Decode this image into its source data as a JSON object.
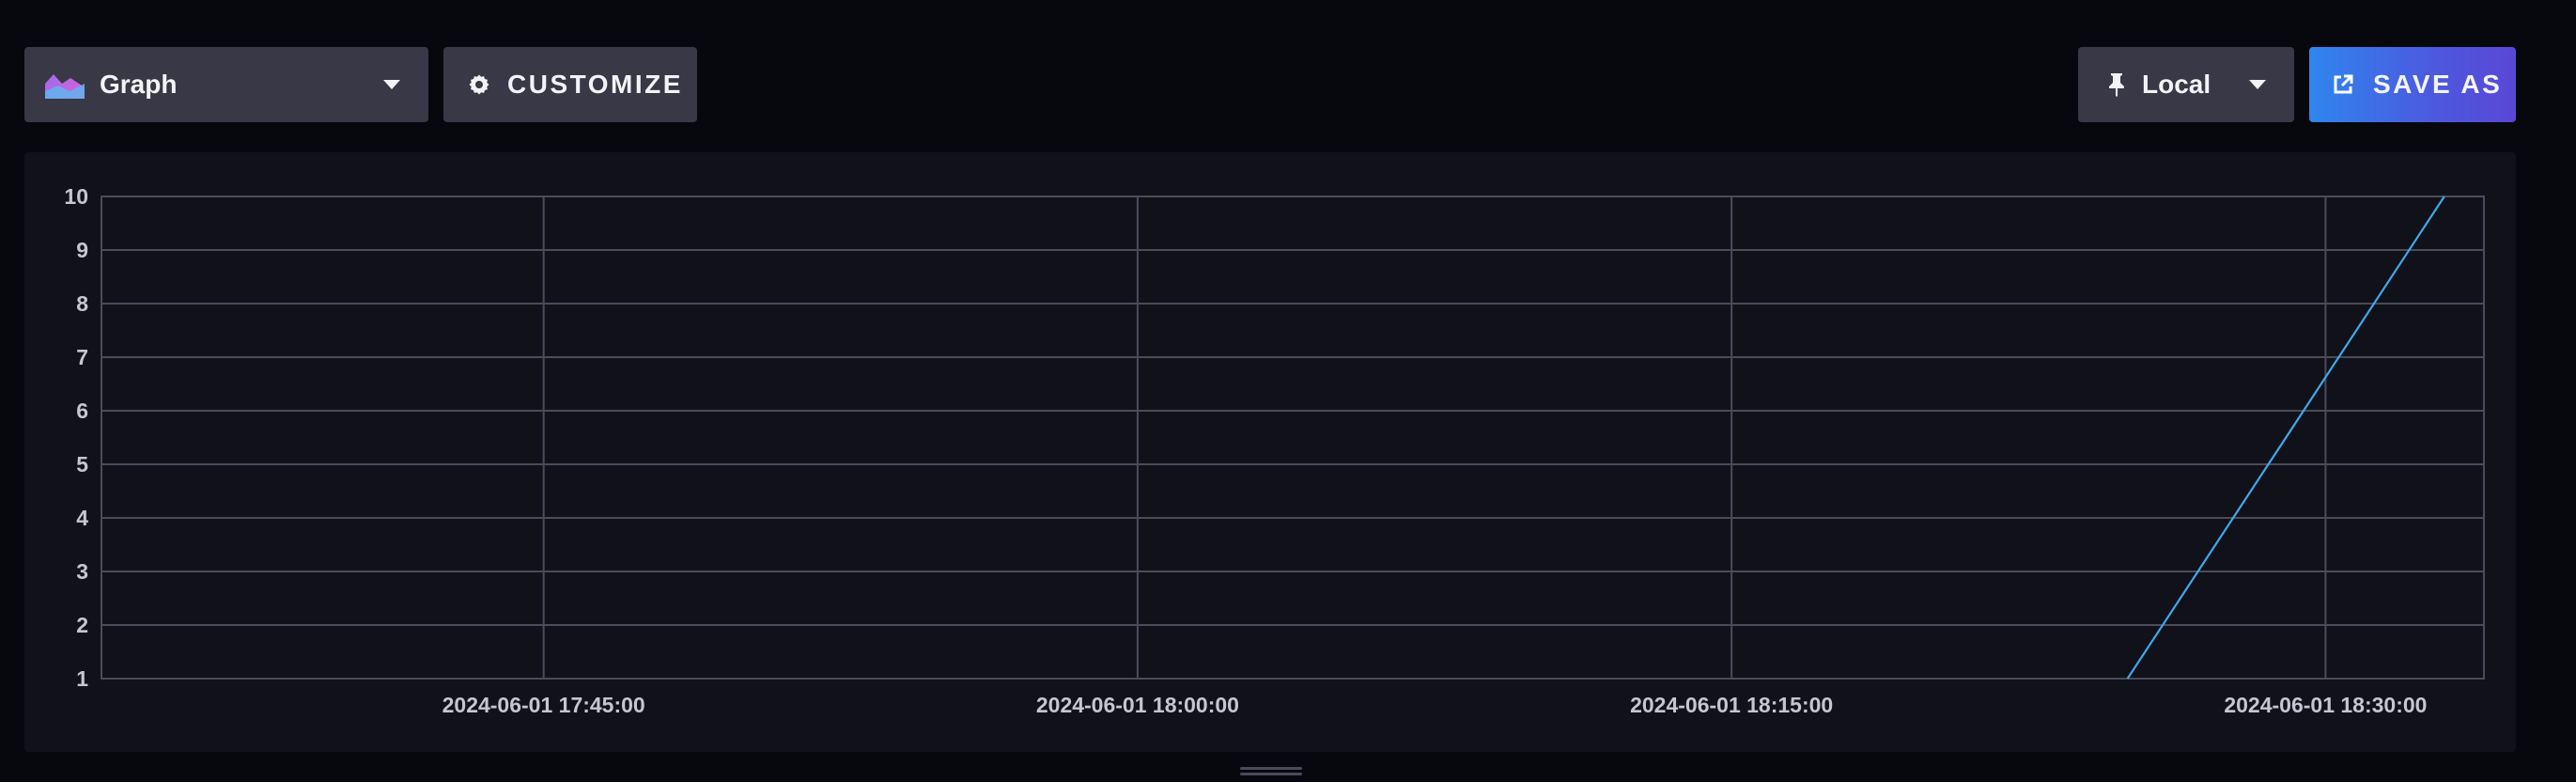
{
  "toolbar": {
    "visualization_label": "Graph",
    "customize_label": "CUSTOMIZE",
    "timezone_label": "Local",
    "save_as_label": "SAVE AS"
  },
  "chart_data": {
    "type": "line",
    "x_ticks": [
      "2024-06-01 17:45:00",
      "2024-06-01 18:00:00",
      "2024-06-01 18:15:00",
      "2024-06-01 18:30:00"
    ],
    "y_ticks": [
      1,
      2,
      3,
      4,
      5,
      6,
      7,
      8,
      9,
      10
    ],
    "xlim": [
      "2024-06-01 17:33:50",
      "2024-06-01 18:34:00"
    ],
    "ylim": [
      1,
      10
    ],
    "grid": true,
    "series": [
      {
        "color": "#3ea8e8",
        "points": [
          {
            "x": "2024-06-01 18:25:00",
            "y": 1
          },
          {
            "x": "2024-06-01 18:33:00",
            "y": 10
          }
        ]
      }
    ]
  }
}
